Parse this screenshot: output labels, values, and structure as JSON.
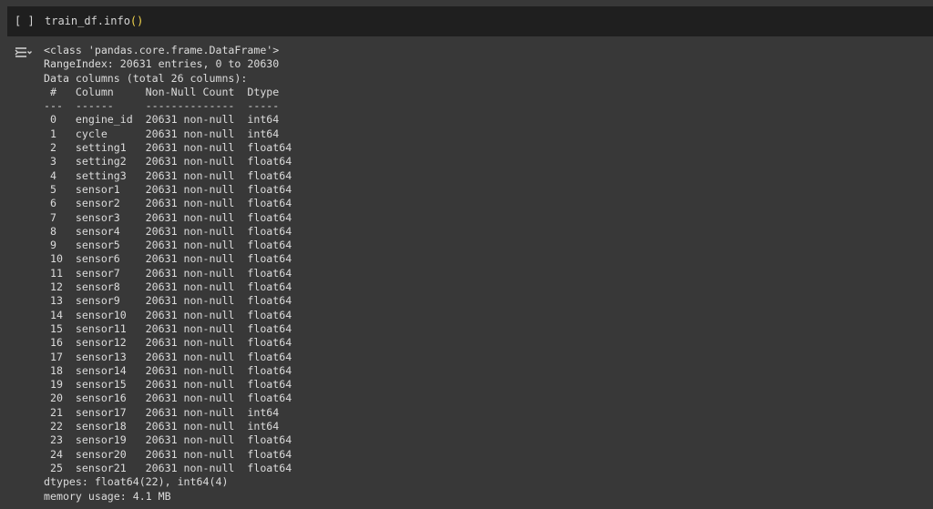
{
  "cell": {
    "run_indicator": "[ ]",
    "code_prefix": "train_df.info",
    "code_parens": "()"
  },
  "output": {
    "lines": [
      "<class 'pandas.core.frame.DataFrame'>",
      "RangeIndex: 20631 entries, 0 to 20630",
      "Data columns (total 26 columns):",
      " #   Column     Non-Null Count  Dtype  ",
      "---  ------     --------------  -----  ",
      " 0   engine_id  20631 non-null  int64  ",
      " 1   cycle      20631 non-null  int64  ",
      " 2   setting1   20631 non-null  float64",
      " 3   setting2   20631 non-null  float64",
      " 4   setting3   20631 non-null  float64",
      " 5   sensor1    20631 non-null  float64",
      " 6   sensor2    20631 non-null  float64",
      " 7   sensor3    20631 non-null  float64",
      " 8   sensor4    20631 non-null  float64",
      " 9   sensor5    20631 non-null  float64",
      " 10  sensor6    20631 non-null  float64",
      " 11  sensor7    20631 non-null  float64",
      " 12  sensor8    20631 non-null  float64",
      " 13  sensor9    20631 non-null  float64",
      " 14  sensor10   20631 non-null  float64",
      " 15  sensor11   20631 non-null  float64",
      " 16  sensor12   20631 non-null  float64",
      " 17  sensor13   20631 non-null  float64",
      " 18  sensor14   20631 non-null  float64",
      " 19  sensor15   20631 non-null  float64",
      " 20  sensor16   20631 non-null  float64",
      " 21  sensor17   20631 non-null  int64  ",
      " 22  sensor18   20631 non-null  int64  ",
      " 23  sensor19   20631 non-null  float64",
      " 24  sensor20   20631 non-null  float64",
      " 25  sensor21   20631 non-null  float64",
      "dtypes: float64(22), int64(4)",
      "memory usage: 4.1 MB"
    ]
  },
  "colors": {
    "background": "#383838",
    "cell_input_bg": "#1f1f1f",
    "text": "#dcdcdc",
    "paren": "#f4d64c"
  },
  "icons": {
    "output_toggle": "output-collapse-icon"
  }
}
